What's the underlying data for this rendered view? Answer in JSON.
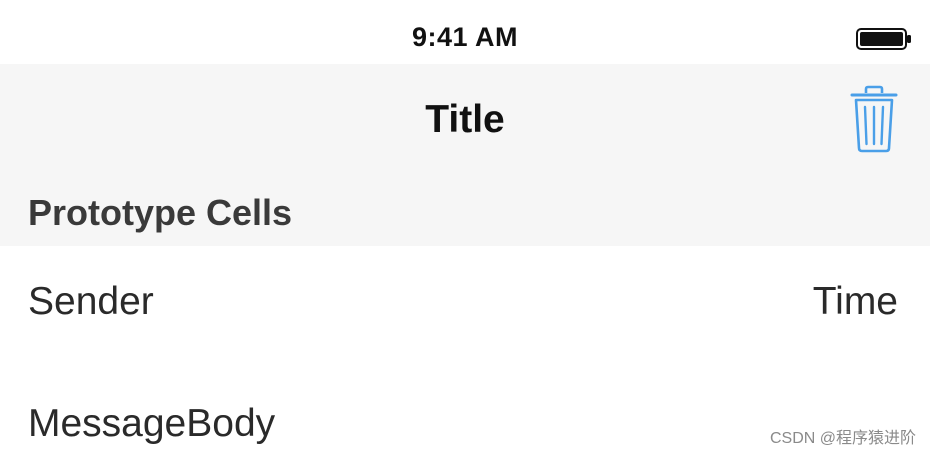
{
  "status_bar": {
    "time": "9:41 AM",
    "battery_icon": "battery-full-icon"
  },
  "nav_bar": {
    "title": "Title",
    "trash_icon": "trash-icon",
    "accent_color": "#4a9fe8"
  },
  "section": {
    "header": "Prototype Cells"
  },
  "cell": {
    "sender": "Sender",
    "time": "Time",
    "message_body": "MessageBody"
  },
  "watermark": "CSDN @程序猿进阶"
}
